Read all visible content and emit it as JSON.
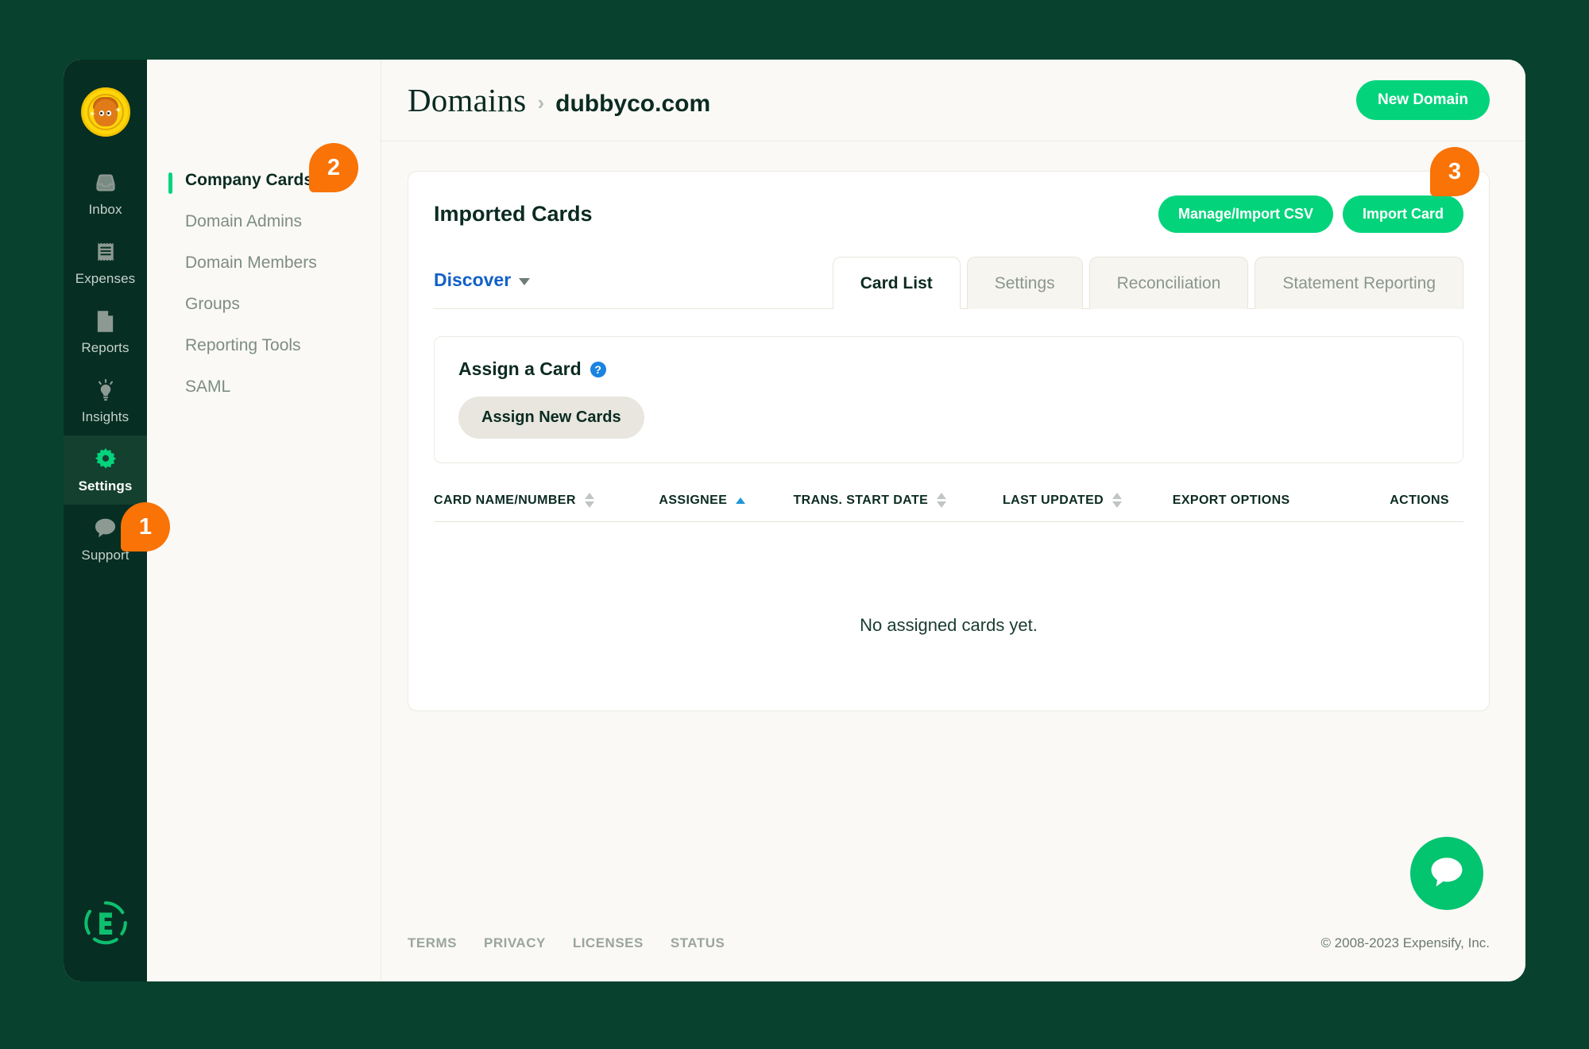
{
  "header": {
    "breadcrumb_root": "Domains",
    "breadcrumb_separator": "›",
    "breadcrumb_current": "dubbyco.com",
    "new_domain_button": "New Domain"
  },
  "rail": {
    "items": [
      {
        "label": "Inbox",
        "icon": "inbox-icon",
        "active": false
      },
      {
        "label": "Expenses",
        "icon": "receipt-icon",
        "active": false
      },
      {
        "label": "Reports",
        "icon": "document-icon",
        "active": false
      },
      {
        "label": "Insights",
        "icon": "lightbulb-icon",
        "active": false
      },
      {
        "label": "Settings",
        "icon": "gear-icon",
        "active": true
      },
      {
        "label": "Support",
        "icon": "chat-icon",
        "active": false
      }
    ]
  },
  "subnav": {
    "items": [
      {
        "label": "Company Cards",
        "active": true
      },
      {
        "label": "Domain Admins",
        "active": false
      },
      {
        "label": "Domain Members",
        "active": false
      },
      {
        "label": "Groups",
        "active": false
      },
      {
        "label": "Reporting Tools",
        "active": false
      },
      {
        "label": "SAML",
        "active": false
      }
    ]
  },
  "panel": {
    "title": "Imported Cards",
    "manage_import_csv_button": "Manage/Import CSV",
    "import_card_button": "Import Card",
    "discover_label": "Discover",
    "tabs": [
      {
        "label": "Card List",
        "active": true
      },
      {
        "label": "Settings",
        "active": false
      },
      {
        "label": "Reconciliation",
        "active": false
      },
      {
        "label": "Statement Reporting",
        "active": false
      }
    ],
    "assign": {
      "title": "Assign a Card",
      "help_icon": "?",
      "assign_new_cards_button": "Assign New Cards"
    },
    "table": {
      "columns": [
        {
          "label": "CARD NAME/NUMBER",
          "sortable": true,
          "sort": "none"
        },
        {
          "label": "ASSIGNEE",
          "sortable": true,
          "sort": "asc"
        },
        {
          "label": "TRANS. START DATE",
          "sortable": true,
          "sort": "none"
        },
        {
          "label": "LAST UPDATED",
          "sortable": true,
          "sort": "none"
        },
        {
          "label": "EXPORT OPTIONS",
          "sortable": false,
          "sort": "none"
        },
        {
          "label": "ACTIONS",
          "sortable": false,
          "sort": "none"
        }
      ],
      "empty_message": "No assigned cards yet."
    }
  },
  "footer": {
    "links": [
      "TERMS",
      "PRIVACY",
      "LICENSES",
      "STATUS"
    ],
    "copyright": "© 2008-2023 Expensify, Inc."
  },
  "badges": [
    {
      "number": "1"
    },
    {
      "number": "2"
    },
    {
      "number": "3"
    }
  ],
  "colors": {
    "page_background": "#08422E",
    "rail_background": "#072E22",
    "surface": "#FAF9F6",
    "accent_green": "#03D47C",
    "badge_orange": "#F97306",
    "link_blue": "#1261C6",
    "sort_active_blue": "#2196D6"
  }
}
